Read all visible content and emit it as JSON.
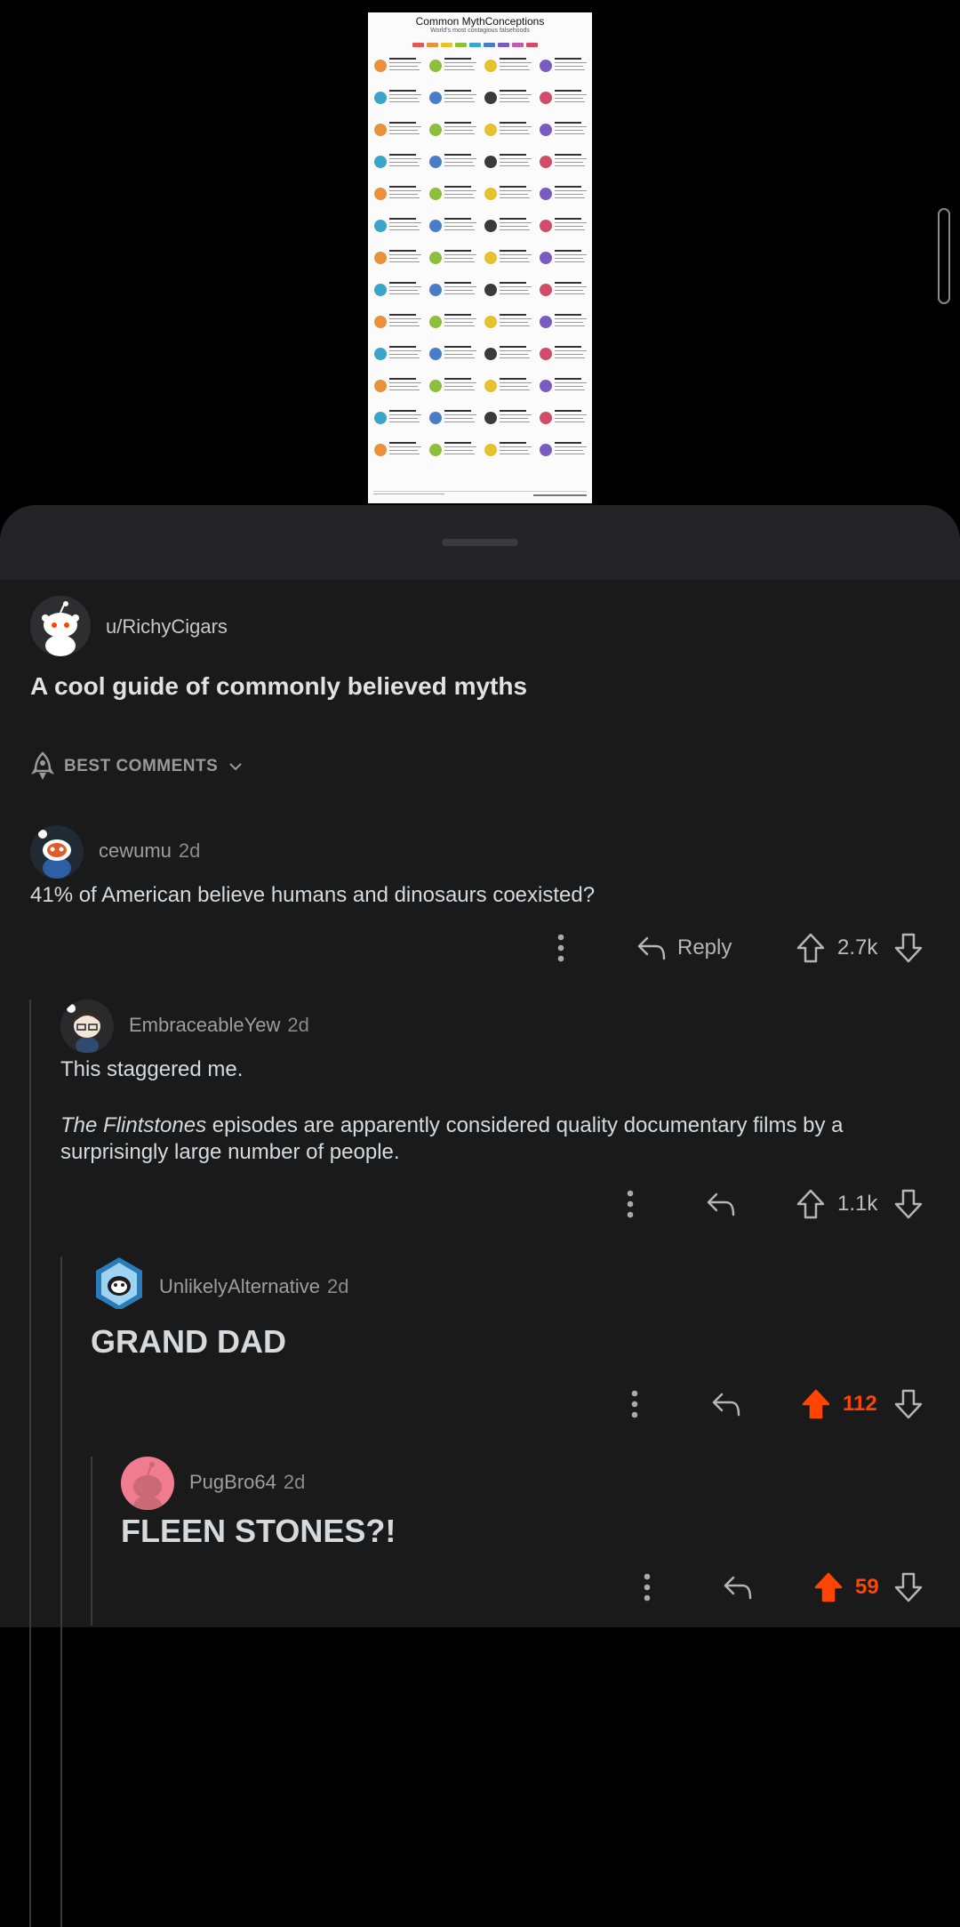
{
  "poster": {
    "title": "Common MythConceptions",
    "subtitle": "World's most contagious falsehoods",
    "legend_colors": [
      "#e05a5a",
      "#e8903a",
      "#e7c12e",
      "#8dbf3b",
      "#3aa6c9",
      "#4a7cc9",
      "#7a5bc2",
      "#c45ba8",
      "#d14b6a"
    ]
  },
  "post": {
    "author": "u/RichyCigars",
    "title": "A cool guide of commonly believed myths",
    "sort_label": "BEST COMMENTS"
  },
  "comments": [
    {
      "author": "cewumu",
      "age": "2d",
      "body": "41% of American believe humans and dinosaurs coexisted?",
      "reply_label": "Reply",
      "score": "2.7k",
      "upvoted": false
    },
    {
      "author": "EmbraceableYew",
      "age": "2d",
      "body_italic": "The Flintstones",
      "body_rest": " episodes are apparently considered quality documentary films by a surprisingly large number of people.",
      "body_first": "This staggered me.",
      "score": "1.1k",
      "upvoted": false
    },
    {
      "author": "UnlikelyAlternative",
      "age": "2d",
      "body": "GRAND DAD",
      "score": "112",
      "upvoted": true
    },
    {
      "author": "PugBro64",
      "age": "2d",
      "body": "FLEEN STONES?!",
      "score": "59",
      "upvoted": true
    }
  ],
  "colors": {
    "accent_upvote": "#ff4500",
    "sheet": "#1a1a1b",
    "text": "#d7dadc"
  }
}
